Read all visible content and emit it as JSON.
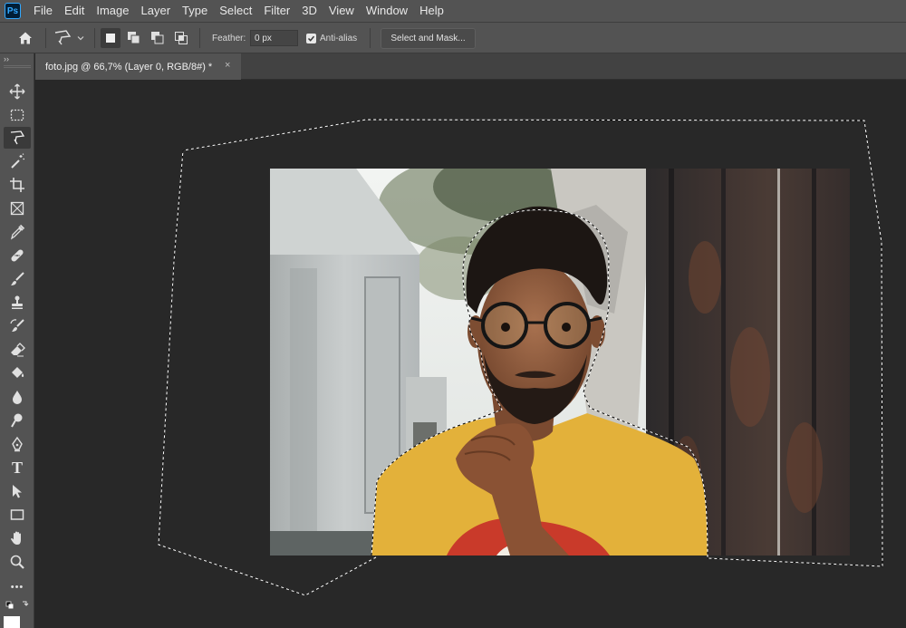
{
  "app": {
    "logo": "Ps"
  },
  "menu": [
    "File",
    "Edit",
    "Image",
    "Layer",
    "Type",
    "Select",
    "Filter",
    "3D",
    "View",
    "Window",
    "Help"
  ],
  "options": {
    "feather_label": "Feather:",
    "feather_value": "0 px",
    "antialias_label": "Anti-alias",
    "antialias_checked": true,
    "select_mask_label": "Select and Mask..."
  },
  "toolbar": {
    "collapse_glyph": "››",
    "tools": [
      "move",
      "rectangular-marquee",
      "polygonal-lasso",
      "magic-wand",
      "crop",
      "frame",
      "eyedropper",
      "spot-healing",
      "brush",
      "clone-stamp",
      "history-brush",
      "eraser",
      "paint-bucket",
      "blur",
      "dodge",
      "pen",
      "type",
      "path-selection",
      "rectangle",
      "hand",
      "zoom",
      "more-tools",
      "default-colors"
    ],
    "type_tool_glyph": "T",
    "more_glyph": "•••",
    "active_tool": "polygonal-lasso"
  },
  "document": {
    "tab_title": "foto.jpg @ 66,7% (Layer 0, RGB/8#) *",
    "close_glyph": "×"
  },
  "colors": {
    "ui_panel": "#535353",
    "canvas_bg": "#282828",
    "tab_bar": "#424242",
    "shirt_yellow": "#e3b13a",
    "accent_blue": "#31a8ff"
  }
}
